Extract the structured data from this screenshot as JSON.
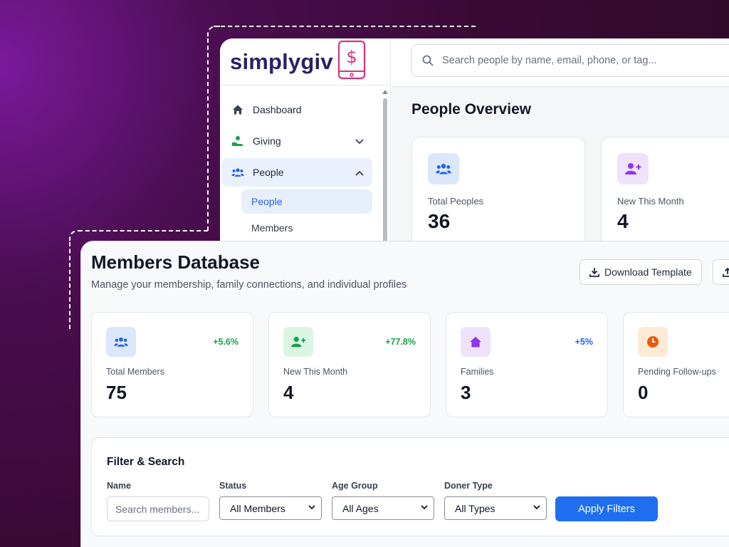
{
  "back_window": {
    "brand": "simplygiv",
    "search_placeholder": "Search people by name, email, phone, or tag...",
    "nav": [
      {
        "label": "Dashboard",
        "icon": "home-icon"
      },
      {
        "label": "Giving",
        "icon": "giving-hand-icon"
      },
      {
        "label": "People",
        "icon": "people-icon"
      }
    ],
    "subnav": [
      "People",
      "Members"
    ],
    "overview_title": "People Overview",
    "cards": [
      {
        "label": "Total Peoples",
        "value": "36",
        "icon": "people-icon"
      },
      {
        "label": "New This Month",
        "value": "4",
        "icon": "user-plus-icon"
      }
    ]
  },
  "members": {
    "title": "Members Database",
    "subtitle": "Manage your membership, family connections, and individual profiles",
    "download_label": "Download Template",
    "stats": [
      {
        "label": "Total Members",
        "value": "75",
        "change": "+5.6%",
        "icon": "people-icon"
      },
      {
        "label": "New This Month",
        "value": "4",
        "change": "+77.8%",
        "icon": "user-plus-icon"
      },
      {
        "label": "Families",
        "value": "3",
        "change": "+5%",
        "icon": "home-icon"
      },
      {
        "label": "Pending Follow-ups",
        "value": "0",
        "change": "",
        "icon": "clock-icon"
      }
    ],
    "filter": {
      "title": "Filter & Search",
      "name_label": "Name",
      "name_placeholder": "Search members...",
      "status_label": "Status",
      "status_value": "All Members",
      "age_label": "Age Group",
      "age_value": "All Ages",
      "doner_label": "Doner Type",
      "doner_value": "All Types",
      "apply_label": "Apply Filters"
    }
  },
  "colors": {
    "primary": "#1f6ef0",
    "positive": "#16a34a",
    "blue_change": "#2563eb",
    "brand_navy": "#2a2262",
    "brand_pink": "#d63384"
  }
}
